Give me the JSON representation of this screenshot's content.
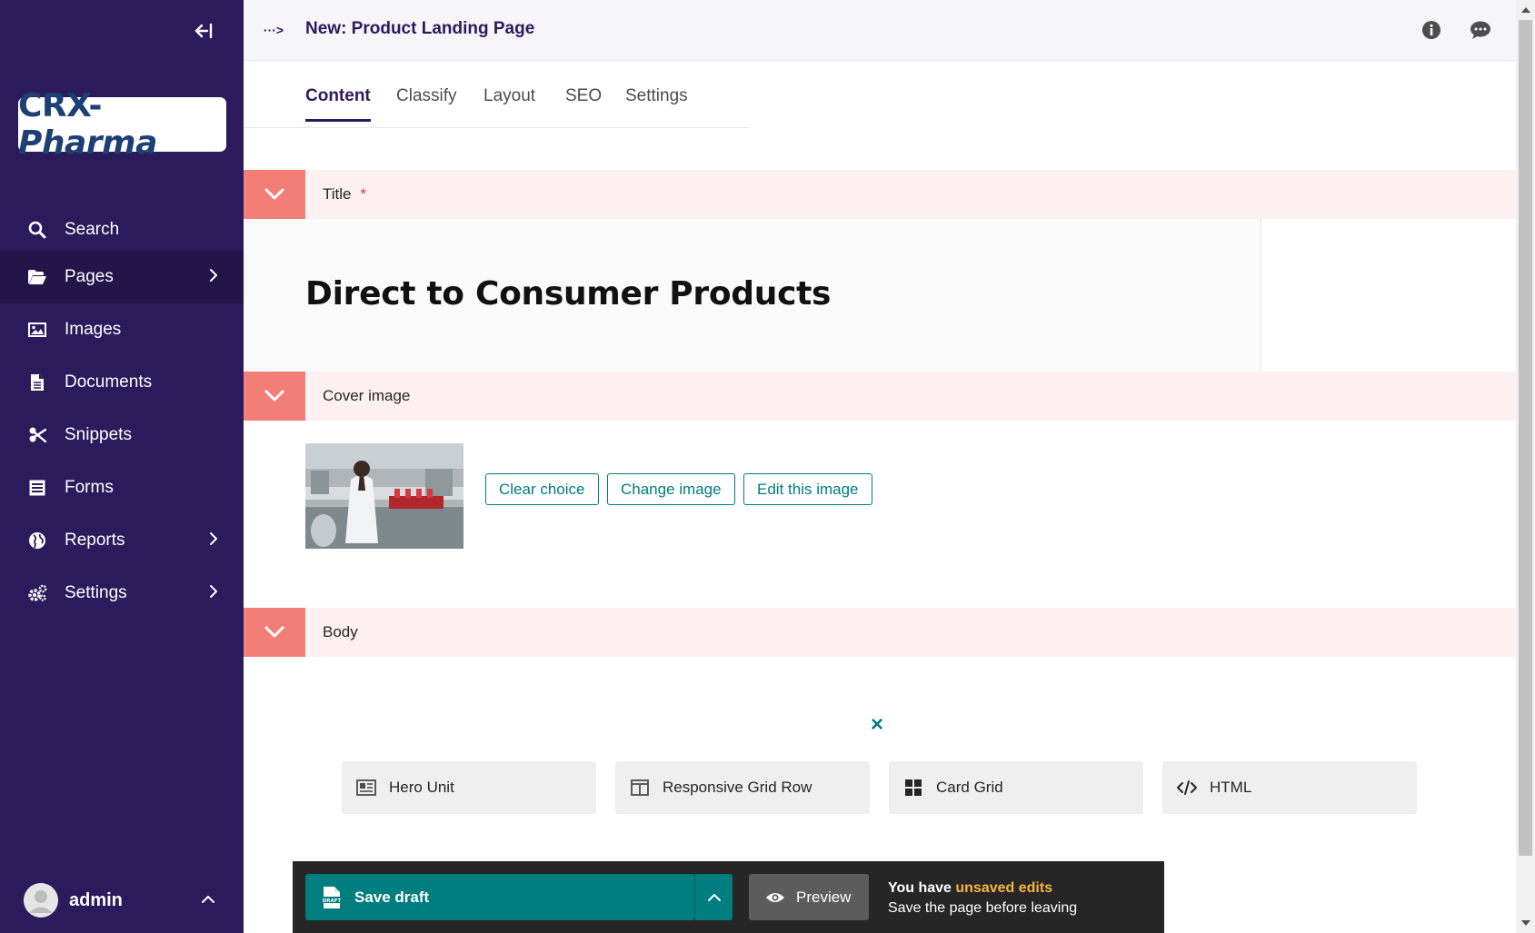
{
  "sidebar": {
    "logo": {
      "part1": "CRX-",
      "part2": "Pharma"
    },
    "items": [
      {
        "label": "Search",
        "icon": "search-icon"
      },
      {
        "label": "Pages",
        "icon": "folder-open-icon",
        "active": true,
        "has_submenu": true
      },
      {
        "label": "Images",
        "icon": "image-icon"
      },
      {
        "label": "Documents",
        "icon": "document-icon"
      },
      {
        "label": "Snippets",
        "icon": "snippet-icon"
      },
      {
        "label": "Forms",
        "icon": "form-icon"
      },
      {
        "label": "Reports",
        "icon": "globe-icon",
        "has_submenu": true
      },
      {
        "label": "Settings",
        "icon": "cogs-icon",
        "has_submenu": true
      }
    ],
    "user": {
      "name": "admin"
    }
  },
  "header": {
    "title": "New: Product Landing Page",
    "breadcrumb_toggle": "···>"
  },
  "tabs": [
    {
      "label": "Content",
      "active": true
    },
    {
      "label": "Classify"
    },
    {
      "label": "Layout"
    },
    {
      "label": "SEO"
    },
    {
      "label": "Settings"
    }
  ],
  "sections": {
    "title": {
      "label": "Title",
      "required_mark": "*",
      "value": "Direct to Consumer Products"
    },
    "cover_image": {
      "label": "Cover image",
      "buttons": {
        "clear": "Clear choice",
        "change": "Change image",
        "edit": "Edit this image"
      }
    },
    "body": {
      "label": "Body",
      "close_symbol": "×",
      "blocks": [
        {
          "label": "Hero Unit",
          "icon": "hero-unit-icon"
        },
        {
          "label": "Responsive Grid Row",
          "icon": "columns-icon"
        },
        {
          "label": "Card Grid",
          "icon": "grid-icon"
        },
        {
          "label": "HTML",
          "icon": "code-icon"
        }
      ]
    }
  },
  "footer": {
    "save_label": "Save draft",
    "save_icon_text": "DRAFT",
    "preview_label": "Preview",
    "unsaved_prefix": "You have ",
    "unsaved_accent": "unsaved edits",
    "unsaved_sub": "Save the page before leaving"
  },
  "colors": {
    "sidebar_bg": "#2b1a5c",
    "accent_teal": "#007d7e",
    "section_toggle": "#f37e77",
    "section_bg": "#fdf0f0",
    "unsaved_accent": "#f8b53c"
  }
}
